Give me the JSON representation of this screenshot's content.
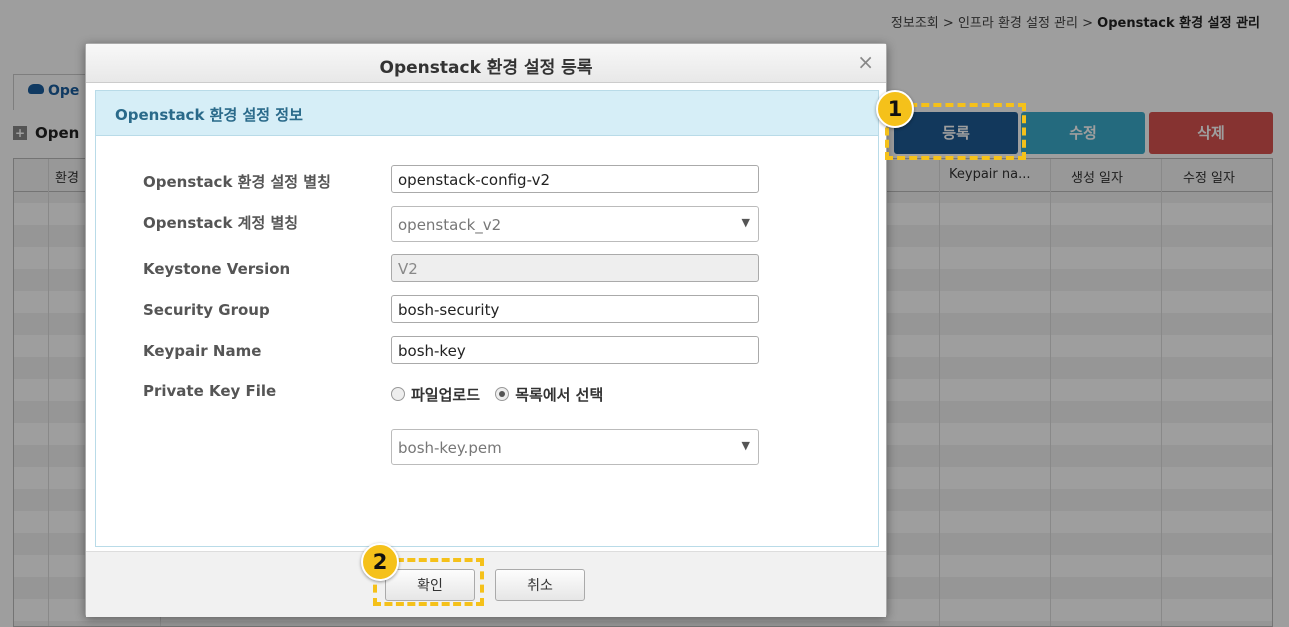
{
  "breadcrumb": {
    "part1": "정보조회",
    "sep": " > ",
    "part2": "인프라 환경 설정 관리",
    "current": "Openstack 환경 설정 관리"
  },
  "background": {
    "tab_label": "Ope",
    "section_title": "Open",
    "buttons": {
      "register": "등록",
      "edit": "수정",
      "delete": "삭제"
    },
    "grid_headers": {
      "col1": "환경",
      "col_keypair": "Keypair na...",
      "col_created": "생성 일자",
      "col_updated": "수정 일자"
    }
  },
  "modal": {
    "title": "Openstack 환경 설정 등록",
    "close_glyph": "×",
    "panel_title": "Openstack 환경 설정 정보",
    "fields": {
      "alias_label": "Openstack 환경 설정 별칭",
      "alias_value": "openstack-config-v2",
      "account_label": "Openstack 계정 별칭",
      "account_value": "openstack_v2",
      "keystone_label": "Keystone Version",
      "keystone_value": "V2",
      "security_label": "Security Group",
      "security_value": "bosh-security",
      "keypair_label": "Keypair Name",
      "keypair_value": "bosh-key",
      "privkey_label": "Private Key File",
      "radio_upload": "파일업로드",
      "radio_select": "목록에서 선택",
      "privkey_value": "bosh-key.pem"
    },
    "footer": {
      "confirm": "확인",
      "cancel": "취소"
    }
  },
  "annotations": {
    "marker1": "1",
    "marker2": "2"
  },
  "colors": {
    "register": "#1d5b95",
    "edit": "#3aaccb",
    "delete": "#d9534f",
    "highlight": "#f5c11a"
  }
}
